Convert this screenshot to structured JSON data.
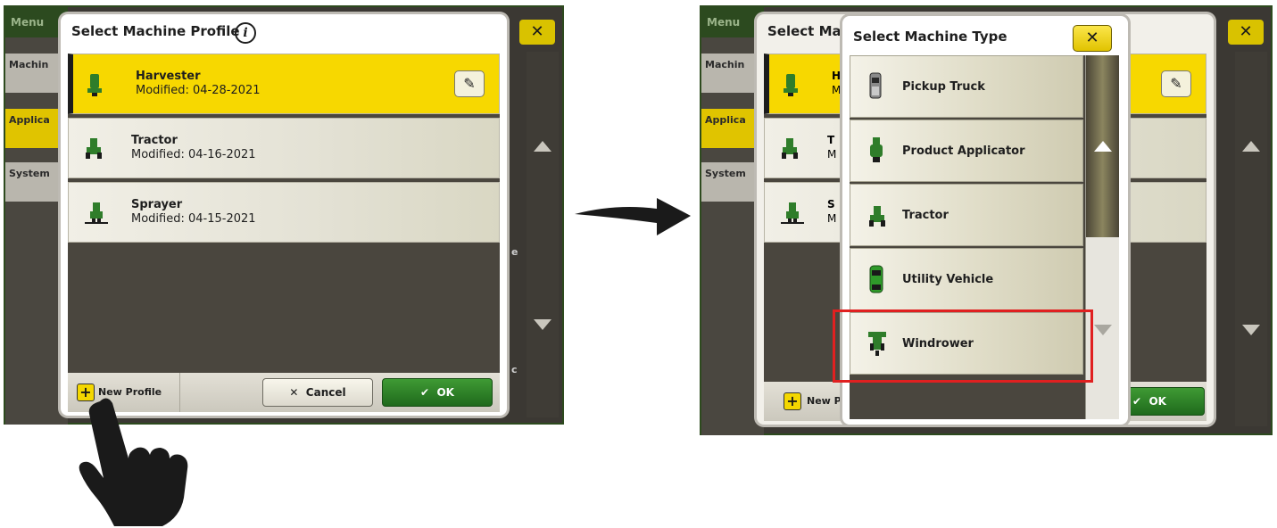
{
  "left_screen": {
    "background": {
      "menu_label": "Menu",
      "tabs": [
        "Machin",
        "Applica",
        "System"
      ],
      "right_fragment": "e",
      "right_fragment2": "c"
    },
    "dialog": {
      "title": "Select Machine Profile",
      "info_icon": "info-icon",
      "profiles": [
        {
          "name": "Harvester",
          "modified": "Modified: 04-28-2021",
          "selected": true,
          "icon": "harvester-icon"
        },
        {
          "name": "Tractor",
          "modified": "Modified: 04-16-2021",
          "selected": false,
          "icon": "tractor-icon"
        },
        {
          "name": "Sprayer",
          "modified": "Modified: 04-15-2021",
          "selected": false,
          "icon": "sprayer-icon"
        }
      ],
      "footer": {
        "new_profile_label": "New Profile",
        "cancel_label": "Cancel",
        "ok_label": "OK"
      }
    }
  },
  "right_screen": {
    "background": {
      "menu_label": "Menu",
      "tabs": [
        "Machin",
        "Applica",
        "System"
      ],
      "behind_title": "Select Mac",
      "behind_letters": [
        "H",
        "M",
        "T",
        "M",
        "S",
        "M"
      ],
      "new_profile_fragment": "New Pr",
      "ok_label": "OK"
    },
    "dialog": {
      "title": "Select Machine Type",
      "close_icon": "close-icon",
      "types": [
        {
          "label": "Pickup Truck",
          "icon": "pickup-truck-icon"
        },
        {
          "label": "Product Applicator",
          "icon": "product-applicator-icon"
        },
        {
          "label": "Tractor",
          "icon": "tractor-icon"
        },
        {
          "label": "Utility Vehicle",
          "icon": "utility-vehicle-icon"
        },
        {
          "label": "Windrower",
          "icon": "windrower-icon",
          "highlighted": true
        }
      ]
    }
  },
  "colors": {
    "accent_yellow": "#f7d800",
    "ok_green": "#2e8a28",
    "highlight_red": "#e02020",
    "frame_green": "#2d4a1e"
  }
}
